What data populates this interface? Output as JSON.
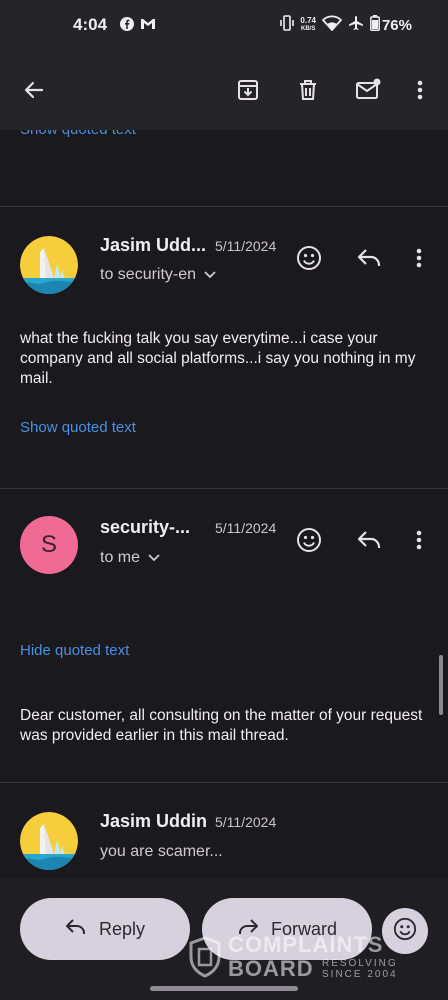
{
  "status_bar": {
    "time": "4:04",
    "net_speed_value": "0.74",
    "net_speed_unit": "KB/S",
    "battery": "76%",
    "icons": [
      "facebook-icon",
      "gmail-icon",
      "vibrate-icon",
      "wifi-icon",
      "airplane-icon",
      "battery-icon"
    ]
  },
  "toolbar": {
    "icons": [
      "back-arrow-icon",
      "archive-icon",
      "delete-icon",
      "mark-unread-icon",
      "more-vert-icon"
    ]
  },
  "thread": {
    "top_link": "Show quoted text",
    "messages": [
      {
        "sender": "Jasim Udd...",
        "date": "5/11/2024",
        "recipient": "to security-en",
        "body": "what the fucking talk you say everytime...i case your company and all social platforms...i say you nothing in my mail.",
        "link": "Show quoted text"
      },
      {
        "sender": "security-...",
        "avatar_letter": "S",
        "avatar_color": "#ef6a95",
        "date": "5/11/2024",
        "recipient": "to me",
        "link": "Hide quoted text",
        "body": "Dear customer, all consulting on the matter of your request was provided earlier in this mail thread."
      },
      {
        "sender": "Jasim Uddin",
        "date": "5/11/2024",
        "snippet": "you are scamer..."
      }
    ]
  },
  "actions": {
    "reply_label": "Reply",
    "forward_label": "Forward"
  },
  "watermark": {
    "line1": "COMPLAINTS",
    "line2": "BOARD",
    "tag1": "RESOLVING",
    "tag2": "SINCE 2004"
  },
  "colors": {
    "background": "#1a191e",
    "link": "#4b8fe0",
    "pill": "#d6d1dc"
  }
}
